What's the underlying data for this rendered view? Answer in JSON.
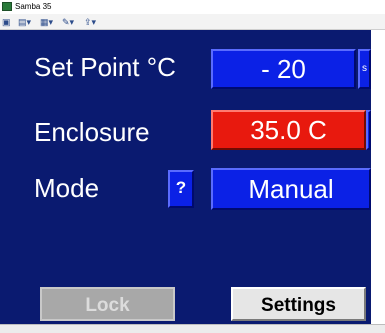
{
  "window": {
    "title": "Samba 35"
  },
  "toolbar": {
    "items": [
      "▣",
      "▤▾",
      "▦▾",
      "✎▾",
      "⇪▾"
    ]
  },
  "rows": {
    "set_point": {
      "label": "Set Point °C",
      "value": "-   20",
      "side": "s"
    },
    "enclosure": {
      "label": "Enclosure",
      "value": "35.0 C"
    },
    "mode": {
      "label": "Mode",
      "help": "?",
      "value": "Manual"
    }
  },
  "buttons": {
    "lock": "Lock",
    "settings": "Settings"
  },
  "colors": {
    "panel": "#0a1a70",
    "blue_box": "#0b21e6",
    "red_box": "#e8190e"
  }
}
